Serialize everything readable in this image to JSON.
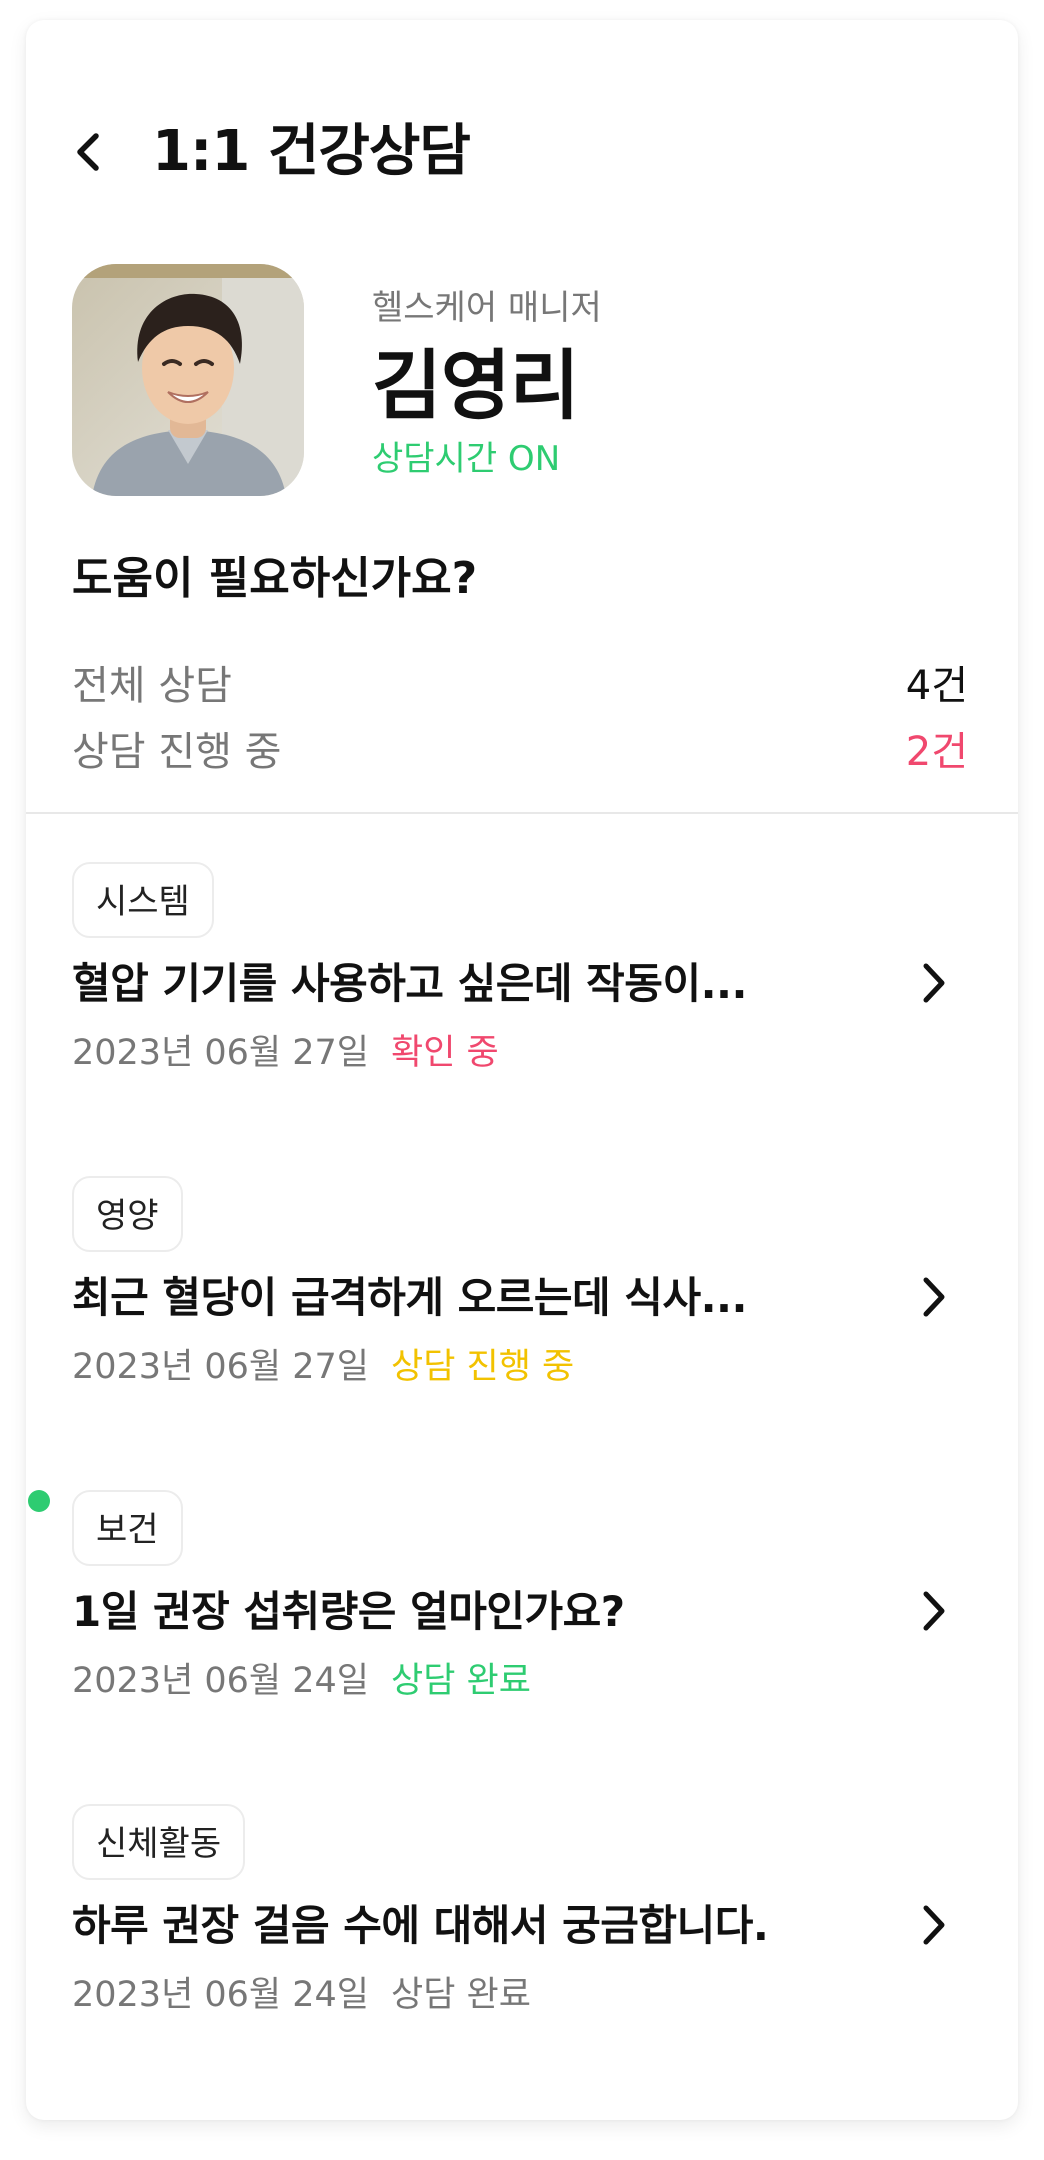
{
  "colors": {
    "accent_green": "#2ecc71",
    "pink": "#f0486e",
    "yellow": "#f2c200",
    "gray_text": "#777777",
    "text": "#111111"
  },
  "header": {
    "back_icon": "chevron-left-icon",
    "title": "1:1 건강상담"
  },
  "manager": {
    "role": "헬스케어 매니저",
    "name": "김영리",
    "status": "상담시간 ON",
    "status_color": "#2ecc71"
  },
  "summary": {
    "heading": "도움이 필요하신가요?",
    "total_label": "전체 상담",
    "total_value": "4건",
    "ongoing_label": "상담 진행 중",
    "ongoing_value": "2건",
    "ongoing_color": "#f0486e"
  },
  "consultations": [
    {
      "tag": "시스템",
      "title": "혈압 기기를 사용하고 싶은데 작동이...",
      "date": "2023년 06월 27일",
      "status": "확인 중",
      "status_color": "#f0486e",
      "has_new": false
    },
    {
      "tag": "영양",
      "title": "최근 혈당이 급격하게 오르는데 식사...",
      "date": "2023년 06월 27일",
      "status": "상담 진행 중",
      "status_color": "#f2c200",
      "has_new": false
    },
    {
      "tag": "보건",
      "title": "1일 권장 섭취량은 얼마인가요?",
      "date": "2023년 06월 24일",
      "status": "상담 완료",
      "status_color": "#2ecc71",
      "has_new": true
    },
    {
      "tag": "신체활동",
      "title": "하루 권장 걸음 수에 대해서 궁금합니다.",
      "date": "2023년 06월 24일",
      "status": "상담 완료",
      "status_color": "#777777",
      "has_new": false
    }
  ]
}
